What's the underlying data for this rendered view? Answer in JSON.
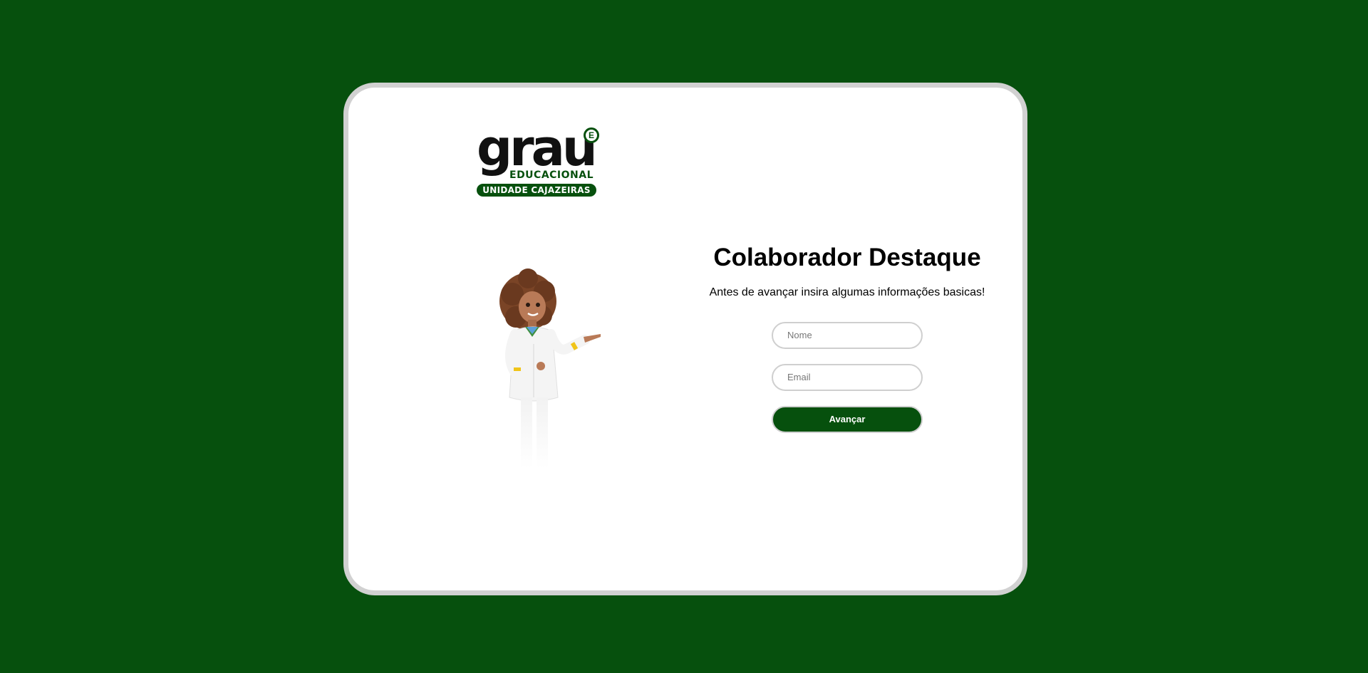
{
  "logo": {
    "word": "grau",
    "badge": "E",
    "subtitle": "EDUCACIONAL",
    "unit": "UNIDADE CAJAZEIRAS"
  },
  "mascot": {
    "icon": "mascot-illustration"
  },
  "form": {
    "title": "Colaborador Destaque",
    "subtitle": "Antes de avançar insira algumas informações basicas!",
    "name_placeholder": "Nome",
    "email_placeholder": "Email",
    "submit_label": "Avançar"
  },
  "colors": {
    "background": "#06500d",
    "accent": "#06500d",
    "card_border": "#d1d1d1"
  }
}
